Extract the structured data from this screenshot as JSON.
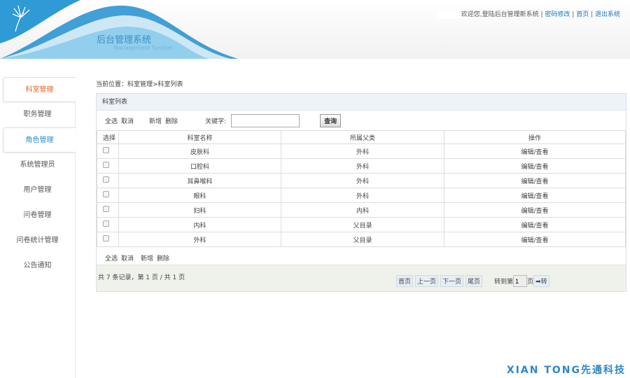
{
  "header": {
    "title": "后台管理系统",
    "subtitle": "Management System",
    "welcome": "欢迎您,登陆后台管理新系统",
    "links": [
      "密码修改",
      "首页",
      "退出系统"
    ]
  },
  "sidebar": {
    "items": [
      {
        "label": "科室管理",
        "color": "#e0682a"
      },
      {
        "label": "职务管理"
      },
      {
        "label": "角色管理",
        "color": "#2b8cc9"
      },
      {
        "label": "系统管理员"
      },
      {
        "label": "用户管理"
      },
      {
        "label": "问卷管理"
      },
      {
        "label": "问卷统计管理"
      },
      {
        "label": "公告通知"
      }
    ]
  },
  "breadcrumb": "当前位置：科室管理>科室列表",
  "panel": {
    "title": "科室列表",
    "select_all": "全选",
    "cancel": "取消",
    "add": "新增",
    "delete": "删除",
    "keyword_label": "关键字:",
    "keyword_value": "",
    "search": "查询"
  },
  "table": {
    "headers": [
      "选择",
      "科室名称",
      "所属父类",
      "操作"
    ],
    "rows": [
      [
        "皮肤科",
        "外科",
        "编辑/查看"
      ],
      [
        "口腔科",
        "外科",
        "编辑/查看"
      ],
      [
        "耳鼻喉科",
        "外科",
        "编辑/查看"
      ],
      [
        "眼科",
        "外科",
        "编辑/查看"
      ],
      [
        "妇科",
        "内科",
        "编辑/查看"
      ],
      [
        "内科",
        "父目录",
        "编辑/查看"
      ],
      [
        "外科",
        "父目录",
        "编辑/查看"
      ]
    ]
  },
  "pager": {
    "summary": "共 7 条记录，第 1 页 / 共 1 页",
    "first": "首页",
    "prev": "上一页",
    "next": "下一页",
    "last": "尾页",
    "goto_pre": "转到第",
    "page_value": "1",
    "goto_post": "页",
    "go": "➡转"
  },
  "watermark": "XIAN  TONG先通科技"
}
